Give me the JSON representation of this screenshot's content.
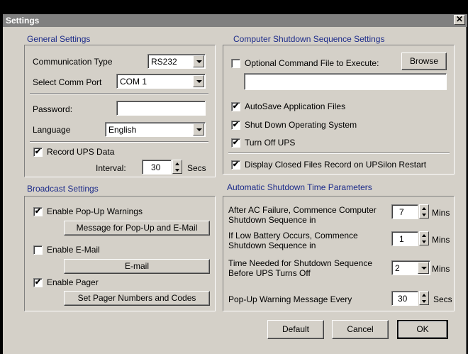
{
  "window": {
    "title": "Settings",
    "close_glyph": "✕"
  },
  "general": {
    "title": "General Settings",
    "comm_type_label": "Communication Type",
    "comm_type_value": "RS232",
    "comm_port_label": "Select Comm Port",
    "comm_port_value": "COM 1",
    "password_label": "Password:",
    "password_value": "",
    "language_label": "Language",
    "language_value": "English",
    "record_label": "Record UPS Data",
    "record_checked": true,
    "interval_label": "Interval:",
    "interval_value": "30",
    "interval_unit": "Secs"
  },
  "shutdown_seq": {
    "title": "Computer Shutdown Sequence Settings",
    "optional_label": "Optional Command File to Execute:",
    "optional_checked": false,
    "browse_label": "Browse",
    "command_file_value": "",
    "autosave_label": "AutoSave Application Files",
    "autosave_checked": true,
    "shutdown_os_label": "Shut Down Operating System",
    "shutdown_os_checked": true,
    "turn_off_label": "Turn Off UPS",
    "turn_off_checked": true,
    "display_closed_label": "Display Closed Files Record on UPSilon Restart",
    "display_closed_checked": true
  },
  "broadcast": {
    "title": "Broadcast Settings",
    "popup_label": "Enable Pop-Up Warnings",
    "popup_checked": true,
    "popup_msg_button": "Message for Pop-Up and E-Mail",
    "email_label": "Enable E-Mail",
    "email_checked": false,
    "email_button": "E-mail",
    "pager_label": "Enable Pager",
    "pager_checked": true,
    "pager_button": "Set Pager Numbers and Codes"
  },
  "auto_shutdown": {
    "title": "Automatic Shutdown Time Parameters",
    "ac_failure_label_1": "After AC Failure, Commence Computer",
    "ac_failure_label_2": "Shutdown Sequence in",
    "ac_failure_value": "7",
    "ac_failure_unit": "Mins",
    "low_battery_label_1": "If Low Battery Occurs, Commence",
    "low_battery_label_2": "Shutdown Sequence in",
    "low_battery_value": "1",
    "low_battery_unit": "Mins",
    "time_needed_label_1": "Time Needed for Shutdown Sequence",
    "time_needed_label_2": "Before UPS Turns Off",
    "time_needed_value": "2",
    "time_needed_unit": "Mins",
    "popup_every_label": "Pop-Up Warning Message Every",
    "popup_every_value": "30",
    "popup_every_unit": "Secs"
  },
  "footer": {
    "default_label": "Default",
    "cancel_label": "Cancel",
    "ok_label": "OK"
  },
  "check_glyph": "✔"
}
